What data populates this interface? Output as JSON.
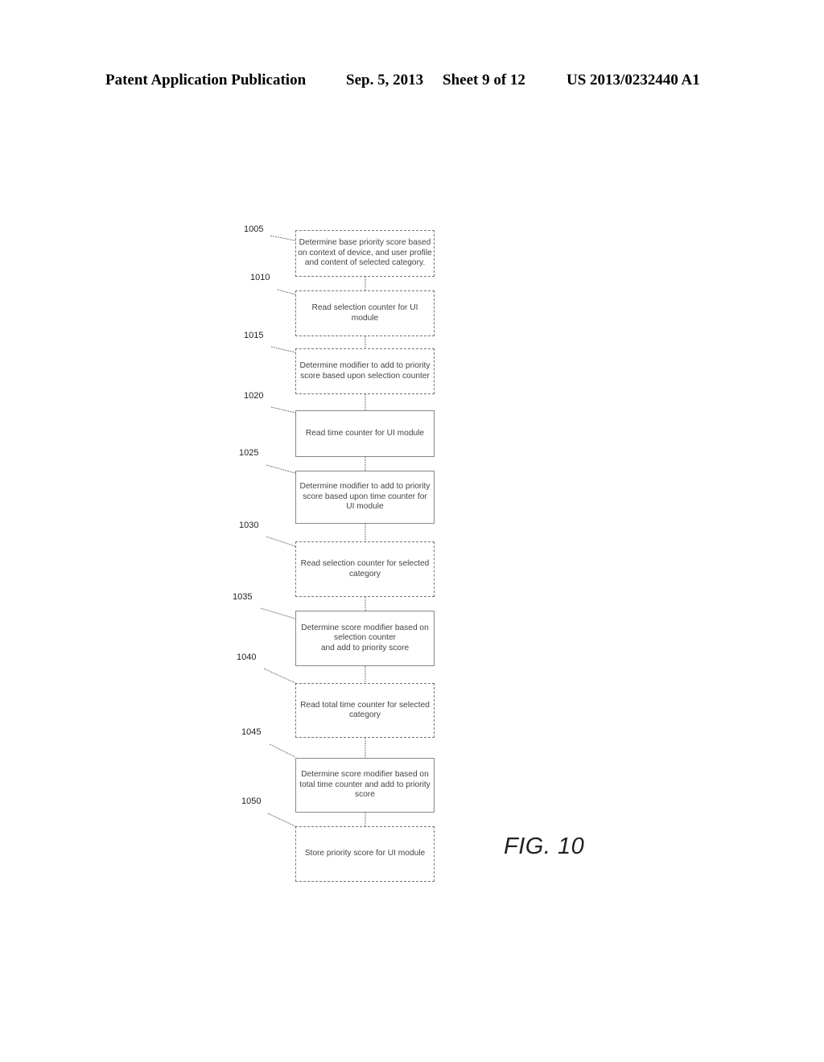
{
  "header": {
    "publication": "Patent Application Publication",
    "date": "Sep. 5, 2013",
    "sheet": "Sheet 9 of 12",
    "number": "US 2013/0232440 A1"
  },
  "figure_label": "FIG. 10",
  "steps": [
    {
      "ref": "1005",
      "text": "Determine base priority score based on context of device, and user profile and content of selected category."
    },
    {
      "ref": "1010",
      "text": "Read selection counter for UI module"
    },
    {
      "ref": "1015",
      "text": "Determine modifier to add to priority score based upon selection counter"
    },
    {
      "ref": "1020",
      "text": "Read time counter for UI module"
    },
    {
      "ref": "1025",
      "text": "Determine modifier to add to priority score based upon time counter for UI module"
    },
    {
      "ref": "1030",
      "text": "Read selection counter for selected category"
    },
    {
      "ref": "1035",
      "text": "Determine score modifier based on selection counter\nand add to priority score"
    },
    {
      "ref": "1040",
      "text": "Read total time  counter for selected category"
    },
    {
      "ref": "1045",
      "text": "Determine score modifier based on total time counter and add to priority score"
    },
    {
      "ref": "1050",
      "text": "Store priority score for UI module"
    }
  ]
}
